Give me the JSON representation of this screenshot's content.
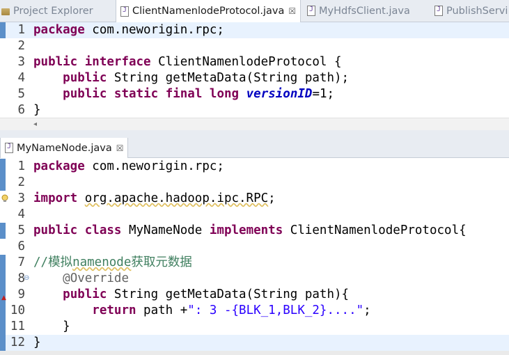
{
  "top_tabs": [
    {
      "label": "Project Explorer",
      "icon": "project-explorer-icon"
    },
    {
      "label": "ClientNamenlodeProtocol.java",
      "icon": "java-file-icon",
      "active": true
    },
    {
      "label": "MyHdfsClient.java",
      "icon": "java-file-icon"
    },
    {
      "label": "PublishServi",
      "icon": "java-file-icon"
    }
  ],
  "bottom_tab": {
    "label": "MyNameNode.java",
    "icon": "java-file-icon"
  },
  "close_glyph": "☒",
  "top_editor": {
    "line_numbers": [
      "1",
      "2",
      "3",
      "4",
      "5",
      "6"
    ],
    "lines": [
      [
        {
          "t": "kw",
          "v": "package"
        },
        {
          "t": "pl",
          "v": " com.neworigin.rpc;"
        }
      ],
      [],
      [
        {
          "t": "kw",
          "v": "public"
        },
        {
          "t": "pl",
          "v": " "
        },
        {
          "t": "kw",
          "v": "interface"
        },
        {
          "t": "pl",
          "v": " ClientNamenlodeProtocol {"
        }
      ],
      [
        {
          "t": "pl",
          "v": "    "
        },
        {
          "t": "kw",
          "v": "public"
        },
        {
          "t": "pl",
          "v": " String getMetaData(String "
        },
        {
          "t": "pl",
          "v": "path"
        },
        {
          "t": "pl",
          "v": ");"
        }
      ],
      [
        {
          "t": "pl",
          "v": "    "
        },
        {
          "t": "kw",
          "v": "public"
        },
        {
          "t": "pl",
          "v": " "
        },
        {
          "t": "kw",
          "v": "static"
        },
        {
          "t": "pl",
          "v": " "
        },
        {
          "t": "kw",
          "v": "final"
        },
        {
          "t": "pl",
          "v": " "
        },
        {
          "t": "kw",
          "v": "long"
        },
        {
          "t": "pl",
          "v": " "
        },
        {
          "t": "fld",
          "v": "versionID"
        },
        {
          "t": "pl",
          "v": "=1;"
        }
      ],
      [
        {
          "t": "pl",
          "v": "}"
        }
      ]
    ],
    "scroll_left_glyph": "◂"
  },
  "bottom_editor": {
    "line_numbers": [
      "1",
      "2",
      "3",
      "4",
      "5",
      "6",
      "7",
      "8",
      "9",
      "10",
      "11",
      "12"
    ],
    "lines": [
      [
        {
          "t": "kw",
          "v": "package"
        },
        {
          "t": "pl",
          "v": " com.neworigin.rpc;"
        }
      ],
      [],
      [
        {
          "t": "kw",
          "v": "import"
        },
        {
          "t": "pl",
          "v": " "
        },
        {
          "t": "sq",
          "v": "org.apache.hadoop.ipc.RPC"
        },
        {
          "t": "pl",
          "v": ";"
        }
      ],
      [],
      [
        {
          "t": "kw",
          "v": "public"
        },
        {
          "t": "pl",
          "v": " "
        },
        {
          "t": "kw",
          "v": "class"
        },
        {
          "t": "pl",
          "v": " MyNameNode "
        },
        {
          "t": "kw",
          "v": "implements"
        },
        {
          "t": "pl",
          "v": " ClientNamenlodeProtocol{"
        }
      ],
      [],
      [
        {
          "t": "cmt",
          "v": "//模拟"
        },
        {
          "t": "cmtsq",
          "v": "namenode"
        },
        {
          "t": "cmt",
          "v": "获取元数据"
        }
      ],
      [
        {
          "t": "pl",
          "v": "    "
        },
        {
          "t": "ann",
          "v": "@Override"
        }
      ],
      [
        {
          "t": "pl",
          "v": "    "
        },
        {
          "t": "kw",
          "v": "public"
        },
        {
          "t": "pl",
          "v": " String getMetaData(String path){"
        }
      ],
      [
        {
          "t": "pl",
          "v": "        "
        },
        {
          "t": "kw",
          "v": "return"
        },
        {
          "t": "pl",
          "v": " path +"
        },
        {
          "t": "str",
          "v": "\": 3 -{BLK_1,BLK_2}....\""
        },
        {
          "t": "pl",
          "v": ";"
        }
      ],
      [
        {
          "t": "pl",
          "v": "    }"
        }
      ],
      [
        {
          "t": "pl",
          "v": "}"
        }
      ]
    ]
  },
  "colors": {
    "keyword": "#7f0055",
    "string": "#2a00ff",
    "comment": "#3f7f5f",
    "annotation": "#646464",
    "field": "#0000c0",
    "highlight": "#e8f2fe"
  }
}
